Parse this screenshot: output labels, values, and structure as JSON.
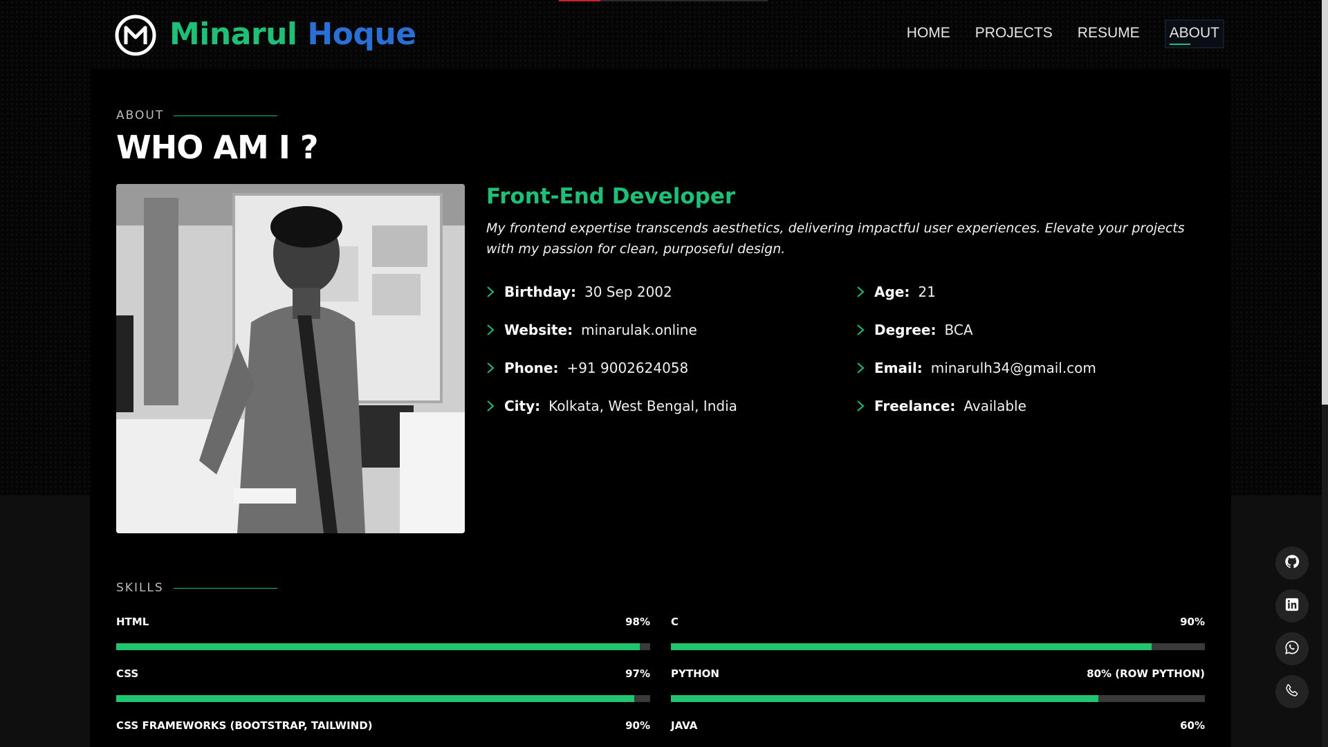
{
  "header": {
    "brand_first": "Minarul",
    "brand_last": "Hoque",
    "nav": [
      "HOME",
      "PROJECTS",
      "RESUME",
      "ABOUT"
    ],
    "active_nav": "ABOUT"
  },
  "about": {
    "label": "ABOUT",
    "title": "WHO AM I ?",
    "role": "Front-End Developer",
    "intro": "My frontend expertise transcends aesthetics, delivering impactful user experiences. Elevate your projects with my passion for clean, purposeful design.",
    "info": [
      {
        "key": "Birthday:",
        "value": "30 Sep 2002"
      },
      {
        "key": "Age:",
        "value": "21"
      },
      {
        "key": "Website:",
        "value": "minarulak.online"
      },
      {
        "key": "Degree:",
        "value": "BCA"
      },
      {
        "key": "Phone:",
        "value": "+91 9002624058"
      },
      {
        "key": "Email:",
        "value": "minarulh34@gmail.com"
      },
      {
        "key": "City:",
        "value": "Kolkata, West Bengal, India"
      },
      {
        "key": "Freelance:",
        "value": "Available"
      }
    ]
  },
  "skills": {
    "label": "SKILLS",
    "items": [
      {
        "name": "HTML",
        "percent_label": "98%",
        "value": 98
      },
      {
        "name": "C",
        "percent_label": "90%",
        "value": 90
      },
      {
        "name": "CSS",
        "percent_label": "97%",
        "value": 97
      },
      {
        "name": "PYTHON",
        "percent_label": "80% (ROW PYTHON)",
        "value": 80
      },
      {
        "name": "CSS FRAMEWORKS (BOOTSTRAP, TAILWIND)",
        "percent_label": "90%",
        "value": 90
      },
      {
        "name": "JAVA",
        "percent_label": "60%",
        "value": 60
      }
    ]
  },
  "social": [
    "github-icon",
    "linkedin-icon",
    "whatsapp-icon",
    "phone-icon"
  ],
  "colors": {
    "accent": "#1fbf78",
    "brand_blue": "#2a6fd6",
    "bar_fill": "#22c56f",
    "bar_track": "#3a3a3a"
  }
}
